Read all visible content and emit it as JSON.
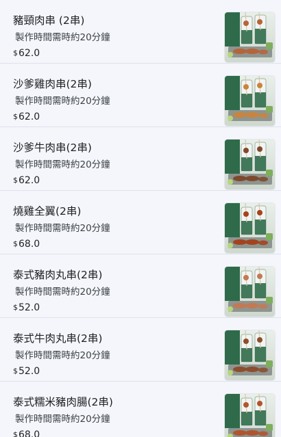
{
  "menu": {
    "currency_symbol": "$",
    "items": [
      {
        "name": "豬頸肉串 (2串)",
        "desc": "製作時間需時約20分鐘",
        "price": "62.0",
        "food_color": "#b5653a"
      },
      {
        "name": "沙爹雞肉串(2串)",
        "desc": "製作時間需時約20分鐘",
        "price": "62.0",
        "food_color": "#c9843e"
      },
      {
        "name": "沙爹牛肉串(2串)",
        "desc": "製作時間需時約20分鐘",
        "price": "62.0",
        "food_color": "#7e4a2c"
      },
      {
        "name": "燒雞全翼(2串)",
        "desc": "製作時間需時約20分鐘",
        "price": "68.0",
        "food_color": "#a3441f"
      },
      {
        "name": "泰式豬肉丸串(2串)",
        "desc": "製作時間需時約20分鐘",
        "price": "52.0",
        "food_color": "#c27a55"
      },
      {
        "name": "泰式牛肉丸串(2串)",
        "desc": "製作時間需時約20分鐘",
        "price": "52.0",
        "food_color": "#8c4e2e"
      },
      {
        "name": "泰式糯米豬肉腸(2串)",
        "desc": "製作時間需時約20分鐘",
        "price": "68.0",
        "food_color": "#b1552f"
      }
    ]
  }
}
